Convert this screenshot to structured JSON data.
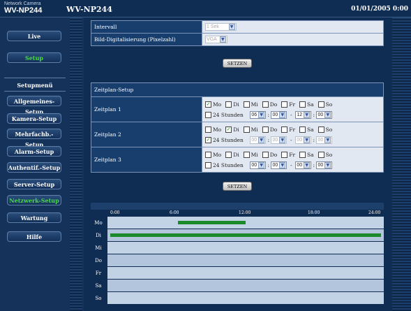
{
  "header": {
    "brand_small": "Network Camera",
    "brand_model": "WV-NP244",
    "model": "WV-NP244",
    "datetime": "01/01/2005  0:00"
  },
  "nav": {
    "live": "Live",
    "setup": "Setup",
    "section": "Setupmenü",
    "items": [
      "Allgemeines-Setup",
      "Kamera-Setup",
      "Mehrfachb.-Setup",
      "Alarm-Setup",
      "Authentif.-Setup",
      "Server-Setup",
      "Netzwerk-Setup",
      "Wartung"
    ],
    "help": "Hilfe"
  },
  "form1": {
    "intervall_label": "Intervall",
    "intervall_value": "1 Sek",
    "resolution_label": "Bild-Digitalisierung (Pixelzahl)",
    "resolution_value": "VGA",
    "set_button": "SETZEN"
  },
  "zeitplan": {
    "heading": "Zeitplan-Setup",
    "plans": [
      {
        "label": "Zeitplan 1",
        "days": [
          "Mo",
          "Di",
          "Mi",
          "Do",
          "Fr",
          "Sa",
          "So"
        ],
        "checked": [
          true,
          false,
          false,
          false,
          false,
          false,
          false
        ],
        "allday_label": "24 Stunden",
        "allday": false,
        "from_h": "06",
        "from_m": "00",
        "to_h": "12",
        "to_m": "00",
        "enabled": true
      },
      {
        "label": "Zeitplan 2",
        "days": [
          "Mo",
          "Di",
          "Mi",
          "Do",
          "Fr",
          "Sa",
          "So"
        ],
        "checked": [
          false,
          true,
          false,
          false,
          false,
          false,
          false
        ],
        "allday_label": "24 Stunden",
        "allday": true,
        "from_h": "00",
        "from_m": "00",
        "to_h": "00",
        "to_m": "00",
        "enabled": false
      },
      {
        "label": "Zeitplan 3",
        "days": [
          "Mo",
          "Di",
          "Mi",
          "Do",
          "Fr",
          "Sa",
          "So"
        ],
        "checked": [
          false,
          false,
          false,
          false,
          false,
          false,
          false
        ],
        "allday_label": "24 Stunden",
        "allday": false,
        "from_h": "00",
        "from_m": "00",
        "to_h": "00",
        "to_m": "00",
        "enabled": true
      }
    ],
    "set_button": "SETZEN",
    "separator": "-"
  },
  "schedule": {
    "ticks": [
      "0:00",
      "6:00",
      "12:00",
      "18:00",
      "24:00"
    ],
    "days": [
      "Mo",
      "Di",
      "Mi",
      "Do",
      "Fr",
      "Sa",
      "So"
    ],
    "bars": [
      {
        "day": "Mo",
        "from": 6,
        "to": 12
      },
      {
        "day": "Di",
        "from": 0,
        "to": 24
      }
    ],
    "bar_color": "#1a8a2a"
  }
}
